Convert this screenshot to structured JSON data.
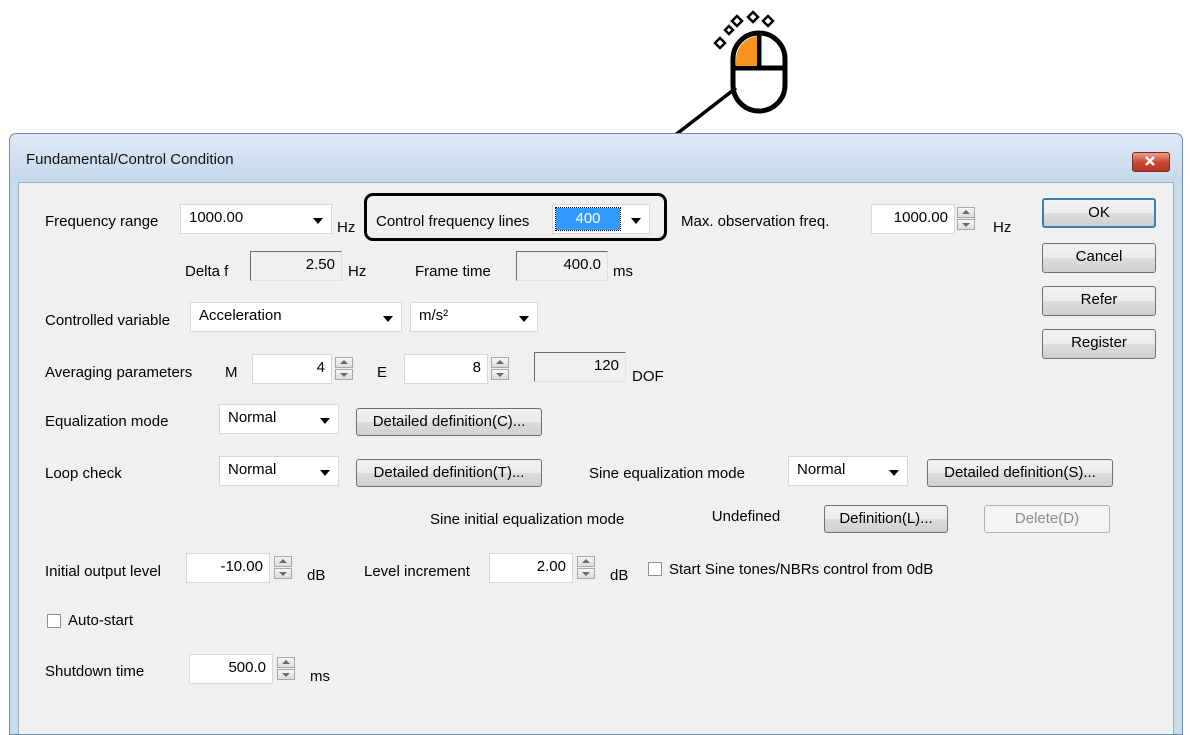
{
  "dialog": {
    "title": "Fundamental/Control Condition",
    "frequency_range": {
      "label": "Frequency range",
      "value": "1000.00",
      "unit": "Hz"
    },
    "control_frequency_lines": {
      "label": "Control frequency lines",
      "value": "400"
    },
    "max_observation_freq": {
      "label": "Max. observation freq.",
      "value": "1000.00",
      "unit": "Hz"
    },
    "delta_f": {
      "label": "Delta f",
      "value": "2.50",
      "unit": "Hz"
    },
    "frame_time": {
      "label": "Frame time",
      "value": "400.0",
      "unit": "ms"
    },
    "controlled_variable": {
      "label": "Controlled variable",
      "value": "Acceleration",
      "unit_value": "m/s²"
    },
    "averaging": {
      "label": "Averaging parameters",
      "m_label": "M",
      "m_value": "4",
      "e_label": "E",
      "e_value": "8",
      "dof_value": "120",
      "dof_label": "DOF"
    },
    "equalization_mode": {
      "label": "Equalization mode",
      "value": "Normal",
      "button": "Detailed definition(C)..."
    },
    "loop_check": {
      "label": "Loop check",
      "value": "Normal",
      "button": "Detailed definition(T)..."
    },
    "sine_equalization_mode": {
      "label": "Sine equalization mode",
      "value": "Normal",
      "button": "Detailed definition(S)..."
    },
    "sine_initial_equalization_mode": {
      "label": "Sine initial equalization mode",
      "value": "Undefined",
      "definition_button": "Definition(L)...",
      "delete_button": "Delete(D)"
    },
    "initial_output_level": {
      "label": "Initial output level",
      "value": "-10.00",
      "unit": "dB"
    },
    "level_increment": {
      "label": "Level increment",
      "value": "2.00",
      "unit": "dB"
    },
    "start_from_0db": {
      "label": "Start Sine tones/NBRs control from 0dB",
      "checked": false
    },
    "auto_start": {
      "label": "Auto-start",
      "checked": false
    },
    "shutdown_time": {
      "label": "Shutdown time",
      "value": "500.0",
      "unit": "ms"
    },
    "buttons": {
      "ok": "OK",
      "cancel": "Cancel",
      "refer": "Refer",
      "register": "Register"
    }
  },
  "annotation": {
    "icon": "mouse-left-click-icon",
    "accent_color": "#f7941d"
  }
}
